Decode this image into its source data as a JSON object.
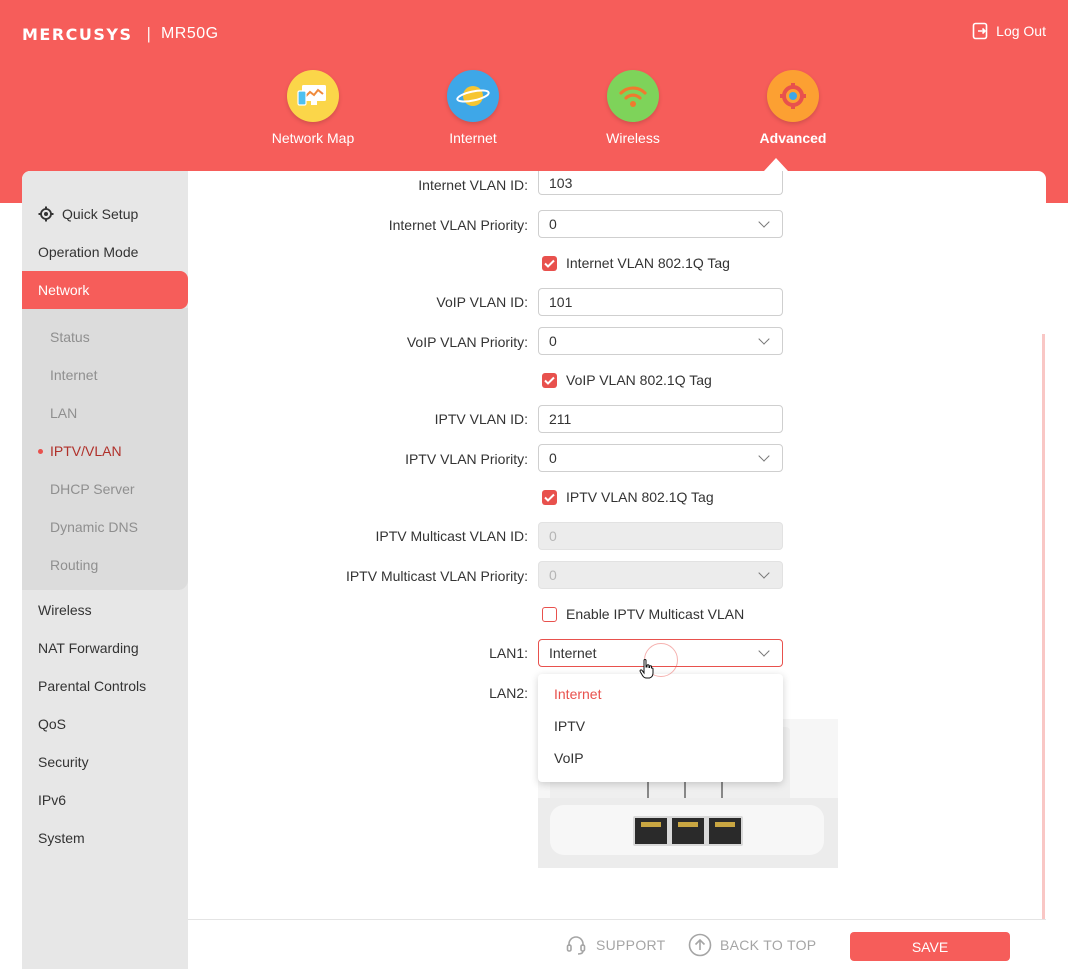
{
  "header": {
    "brand": "MERCUSYS",
    "separator": "|",
    "model": "MR50G",
    "logout_label": "Log Out"
  },
  "topnav": [
    {
      "label": "Network Map",
      "icon": "network-map-icon",
      "color": "#fbd649"
    },
    {
      "label": "Internet",
      "icon": "globe-icon",
      "color": "#3ea7e8"
    },
    {
      "label": "Wireless",
      "icon": "wifi-icon",
      "color": "#7ed35a"
    },
    {
      "label": "Advanced",
      "icon": "gear-icon",
      "color": "#fca032",
      "active": true
    }
  ],
  "sidebar": {
    "items": [
      {
        "label": "Quick Setup",
        "icon": "gear-icon"
      },
      {
        "label": "Operation Mode"
      },
      {
        "label": "Network",
        "active": true
      },
      {
        "label": "Wireless"
      },
      {
        "label": "NAT Forwarding"
      },
      {
        "label": "Parental Controls"
      },
      {
        "label": "QoS"
      },
      {
        "label": "Security"
      },
      {
        "label": "IPv6"
      },
      {
        "label": "System"
      }
    ],
    "network_sub": [
      {
        "label": "Status"
      },
      {
        "label": "Internet"
      },
      {
        "label": "LAN"
      },
      {
        "label": "IPTV/VLAN",
        "active": true
      },
      {
        "label": "DHCP Server"
      },
      {
        "label": "Dynamic DNS"
      },
      {
        "label": "Routing"
      }
    ]
  },
  "form": {
    "internet_vlan_id": {
      "label": "Internet VLAN ID:",
      "value": "103"
    },
    "internet_vlan_priority": {
      "label": "Internet VLAN Priority:",
      "value": "0"
    },
    "internet_tag": {
      "label": "Internet VLAN 802.1Q Tag",
      "checked": true
    },
    "voip_vlan_id": {
      "label": "VoIP VLAN ID:",
      "value": "101"
    },
    "voip_vlan_priority": {
      "label": "VoIP VLAN Priority:",
      "value": "0"
    },
    "voip_tag": {
      "label": "VoIP VLAN 802.1Q Tag",
      "checked": true
    },
    "iptv_vlan_id": {
      "label": "IPTV VLAN ID:",
      "value": "211"
    },
    "iptv_vlan_priority": {
      "label": "IPTV VLAN Priority:",
      "value": "0"
    },
    "iptv_tag": {
      "label": "IPTV VLAN 802.1Q Tag",
      "checked": true
    },
    "iptv_multicast_vlan_id": {
      "label": "IPTV Multicast VLAN ID:",
      "value": "0"
    },
    "iptv_multicast_vlan_priority": {
      "label": "IPTV Multicast VLAN Priority:",
      "value": "0"
    },
    "enable_iptv_multicast": {
      "label": "Enable IPTV Multicast VLAN",
      "checked": false
    },
    "lan1": {
      "label": "LAN1:",
      "value": "Internet"
    },
    "lan2": {
      "label": "LAN2:"
    },
    "lan1_options": [
      "Internet",
      "IPTV",
      "VoIP"
    ]
  },
  "footer": {
    "support_label": "SUPPORT",
    "back_to_top_label": "BACK TO TOP",
    "save_label": "SAVE"
  },
  "colors": {
    "accent": "#f65d5a",
    "active_text": "#e8514d"
  }
}
